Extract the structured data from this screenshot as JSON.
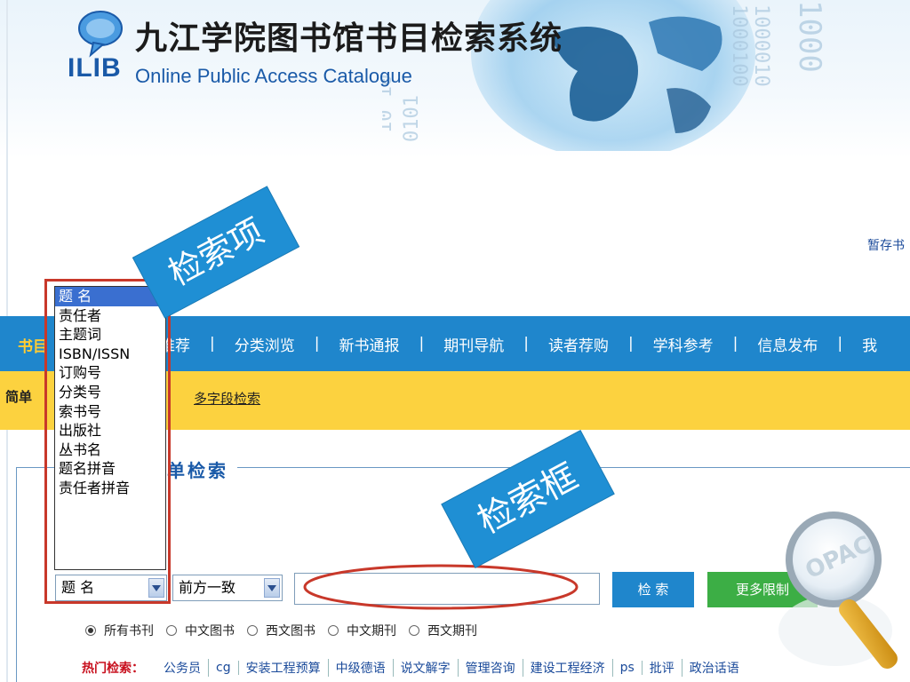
{
  "header": {
    "logo_text": "ILIB",
    "title": "九江学院图书馆书目检索系统",
    "subtitle": "Online Public Access Catalogue"
  },
  "cart_link": "暂存书",
  "nav": {
    "first": "书目",
    "items": [
      "推荐",
      "分类浏览",
      "新书通报",
      "期刊导航",
      "读者荐购",
      "学科参考",
      "信息发布",
      "我"
    ]
  },
  "subnav": {
    "first": "简单",
    "link": "多字段检索"
  },
  "section": {
    "title": "单检索"
  },
  "callouts": {
    "field": "检索项",
    "box": "检索框"
  },
  "field_select": {
    "value": "题 名",
    "options": [
      "题 名",
      "责任者",
      "主题词",
      "ISBN/ISSN",
      "订购号",
      "分类号",
      "索书号",
      "出版社",
      "丛书名",
      "题名拼音",
      "责任者拼音"
    ],
    "selected_index": 0
  },
  "match_select": {
    "value": "前方一致"
  },
  "search": {
    "value": "",
    "button": "检 索",
    "more_button": "更多限制"
  },
  "doc_types": {
    "options": [
      "所有书刊",
      "中文图书",
      "西文图书",
      "中文期刊",
      "西文期刊"
    ],
    "selected_index": 0
  },
  "hot": {
    "label": "热门检索：",
    "items": [
      "公务员",
      "cg",
      "安装工程预算",
      "中级德语",
      "说文解字",
      "管理咨询",
      "建设工程经济",
      "ps",
      "批评",
      "政治话语"
    ]
  },
  "colors": {
    "nav_blue": "#1f86cc",
    "sub_yellow": "#fcd23f",
    "callout_blue": "#1f8fd4",
    "annotation_red": "#c8382a",
    "more_green": "#3cae45"
  }
}
